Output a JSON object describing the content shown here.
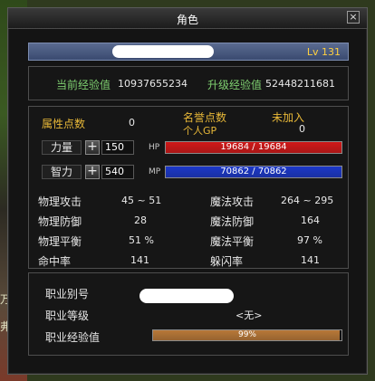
{
  "window": {
    "title": "角色",
    "close_icon": "×"
  },
  "character": {
    "level": "Lv 131"
  },
  "experience": {
    "current_label": "当前经验值",
    "current_value": "10937655234",
    "upgrade_label": "升级经验值",
    "upgrade_value": "52448211681"
  },
  "points": {
    "attribute_label": "属性点数",
    "attribute_value": "0",
    "fame_label": "名誉点数",
    "fame_status": "未加入",
    "personal_gp_label": "个人GP",
    "personal_gp_value": "0"
  },
  "stats": {
    "strength": {
      "label": "力量",
      "value": "150",
      "bar_label": "HP",
      "bar_text": "19684 / 19684",
      "fill_fraction": 1.0
    },
    "intellect": {
      "label": "智力",
      "value": "540",
      "bar_label": "MP",
      "bar_text": "70862 / 70862",
      "fill_fraction": 1.0
    },
    "plus_icon": "+"
  },
  "combat": {
    "phys_attack_label": "物理攻击",
    "phys_attack_value": "45 ~ 51",
    "magic_attack_label": "魔法攻击",
    "magic_attack_value": "264 ~ 295",
    "phys_defense_label": "物理防御",
    "phys_defense_value": "28",
    "magic_defense_label": "魔法防御",
    "magic_defense_value": "164",
    "phys_balance_label": "物理平衡",
    "phys_balance_value": "51 %",
    "magic_balance_label": "魔法平衡",
    "magic_balance_value": "97 %",
    "hit_label": "命中率",
    "hit_value": "141",
    "dodge_label": "躲闪率",
    "dodge_value": "141"
  },
  "job": {
    "alias_label": "职业别号",
    "level_label": "职业等级",
    "level_value": "<无>",
    "exp_label": "职业经验值",
    "exp_text": "99%",
    "exp_fraction": 0.99
  },
  "background": {
    "left_text_1": "万刹",
    "left_text_2": "弗孔"
  },
  "colors": {
    "hp_fill": "#d01818",
    "mp_fill": "#1c38c8",
    "job_exp_fill": "#b87838",
    "gold_label": "#e8b838",
    "green_label": "#7fd070",
    "level_text": "#ffd040"
  }
}
